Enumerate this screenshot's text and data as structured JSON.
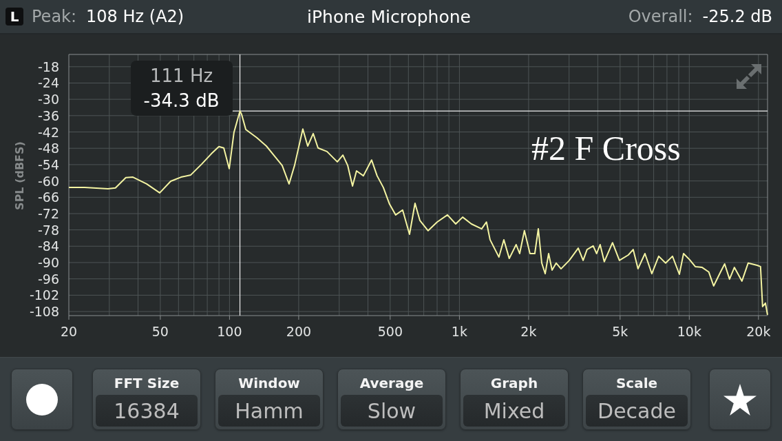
{
  "header": {
    "channel": "L",
    "peak_label": "Peak:",
    "peak_value": "108 Hz (A2)",
    "source": "iPhone Microphone",
    "overall_label": "Overall:",
    "overall_value": "-25.2 dB"
  },
  "spectrum": {
    "chart_data": {
      "type": "line",
      "ylabel": "SPL (dBFS)",
      "log": "x",
      "grid": true,
      "x": [
        20,
        23.4,
        29.6,
        31.9,
        35.4,
        38,
        43.6,
        49.7,
        55.5,
        61.5,
        67.8,
        75.7,
        83.4,
        89.9,
        94.4,
        99.7,
        104.6,
        111,
        112.9,
        117.7,
        131.4,
        144.7,
        158.2,
        169.5,
        181.6,
        191.9,
        208.4,
        218.8,
        231.2,
        242.7,
        265.5,
        294.4,
        311.2,
        326.6,
        342.7,
        356.8,
        382.3,
        415,
        438.6,
        466.8,
        496.6,
        528.4,
        566.2,
        606.7,
        641.1,
        673,
        731,
        800,
        887,
        964,
        1033,
        1128,
        1250,
        1312,
        1359,
        1486,
        1560,
        1648,
        1766,
        1828,
        1918,
        2028,
        2128,
        2204,
        2281,
        2361,
        2444,
        2530,
        2637,
        2768,
        3007,
        3289,
        3453,
        3592,
        3820,
        3954,
        4094,
        4266,
        4634,
        4966,
        5432,
        5702,
        5984,
        6412,
        6871,
        7362,
        7889,
        8453,
        9057,
        9441,
        10046,
        10617,
        11378,
        12162,
        12766,
        13678,
        14256,
        14964,
        15706,
        16944,
        18030,
        19724,
        20418,
        20840,
        21430,
        21880
      ],
      "series": [
        {
          "color": "#f4f4a2",
          "values": [
            -62.4,
            -62.4,
            -62.9,
            -62.6,
            -58.8,
            -58.6,
            -61.1,
            -64.4,
            -60.1,
            -58.6,
            -57.8,
            -53.8,
            -50,
            -47.4,
            -47.9,
            -55.5,
            -42.1,
            -34.3,
            -35.5,
            -41.1,
            -44.1,
            -47.2,
            -51.2,
            -54.3,
            -61.1,
            -54.3,
            -40.9,
            -47.2,
            -42.6,
            -47.9,
            -49.2,
            -53,
            -50.5,
            -54.3,
            -61.9,
            -56.3,
            -58.1,
            -52.3,
            -58.1,
            -62.4,
            -68.5,
            -72.5,
            -70.7,
            -79.6,
            -68.2,
            -74.5,
            -78.3,
            -75.1,
            -72.5,
            -75.8,
            -73.3,
            -75.8,
            -77.6,
            -75.1,
            -81.6,
            -88,
            -81.6,
            -88.5,
            -83.4,
            -86.7,
            -78.3,
            -86.7,
            -86.7,
            -77.6,
            -90.2,
            -94.1,
            -86.7,
            -92.8,
            -90.2,
            -92.3,
            -89.2,
            -84.7,
            -89.2,
            -85.2,
            -83.9,
            -86.7,
            -83.4,
            -89.7,
            -82.7,
            -89.2,
            -87.2,
            -85.2,
            -92.3,
            -86.7,
            -94.1,
            -87.7,
            -90.2,
            -87.7,
            -94.3,
            -86.7,
            -89,
            -91.5,
            -91.8,
            -93.5,
            -98.6,
            -93.5,
            -90.5,
            -96.1,
            -91.8,
            -96.8,
            -90.2,
            -91,
            -91.5,
            -106.2,
            -104.9,
            -109.2
          ]
        }
      ],
      "xlim": [
        20,
        21900
      ],
      "ylim": [
        -109.5,
        -13.5
      ],
      "xticks": [
        {
          "value": 20,
          "label": "20"
        },
        {
          "value": 50,
          "label": "50"
        },
        {
          "value": 100,
          "label": "100"
        },
        {
          "value": 200,
          "label": "200"
        },
        {
          "value": 500,
          "label": "500"
        },
        {
          "value": 1000,
          "label": "1k"
        },
        {
          "value": 2000,
          "label": "2k"
        },
        {
          "value": 5000,
          "label": "5k"
        },
        {
          "value": 10000,
          "label": "10k"
        },
        {
          "value": 20000,
          "label": "20k"
        }
      ],
      "yticks": [
        -18,
        -24,
        -30,
        -36,
        -42,
        -48,
        -54,
        -60,
        -66,
        -72,
        -78,
        -84,
        -90,
        -96,
        -102,
        -108
      ],
      "ref_lines": [
        {
          "axis": "x",
          "value": 111
        },
        {
          "axis": "y",
          "value": -34.3
        }
      ]
    },
    "cursor_readout": {
      "frequency": "111 Hz",
      "magnitude": "-34.3 dB"
    },
    "caption": "#2 F Cross"
  },
  "controls": [
    {
      "kind": "record"
    },
    {
      "kind": "setting",
      "label": "FFT Size",
      "value": "16384"
    },
    {
      "kind": "setting",
      "label": "Window",
      "value": "Hamm"
    },
    {
      "kind": "setting",
      "label": "Average",
      "value": "Slow"
    },
    {
      "kind": "setting",
      "label": "Graph",
      "value": "Mixed"
    },
    {
      "kind": "setting",
      "label": "Scale",
      "value": "Decade"
    },
    {
      "kind": "favorite"
    }
  ]
}
